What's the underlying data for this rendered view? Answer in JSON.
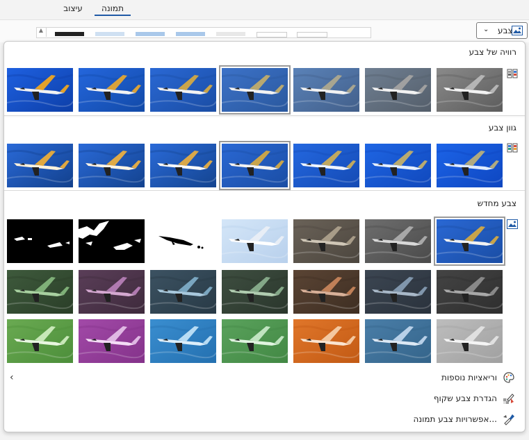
{
  "ribbon": {
    "tabs": [
      {
        "label": "עיצוב",
        "active": false
      },
      {
        "label": "תמונה",
        "active": true
      }
    ],
    "color_button": {
      "label": "צבע",
      "icon": "picture-color-icon"
    }
  },
  "panel": {
    "sections": [
      {
        "title": "רוויה של צבע",
        "icon": "saturation-icon"
      },
      {
        "title": "גוון צבע",
        "icon": "tone-icon"
      },
      {
        "title": "צבע מחדש",
        "icon": "recolor-icon"
      }
    ],
    "menu": [
      {
        "label": "וריאציות נוספות",
        "icon": "palette-icon"
      },
      {
        "label": "הגדרת צבע שקוף",
        "icon": "transparent-color-icon"
      },
      {
        "label": "אפשרויות צבע תמונה...",
        "icon": "picture-color-options-icon"
      }
    ]
  },
  "colors": {
    "accent": "#1f5aa6",
    "sky_blue": "#2f6fd0",
    "selected_outline": "#9a9a9a"
  }
}
